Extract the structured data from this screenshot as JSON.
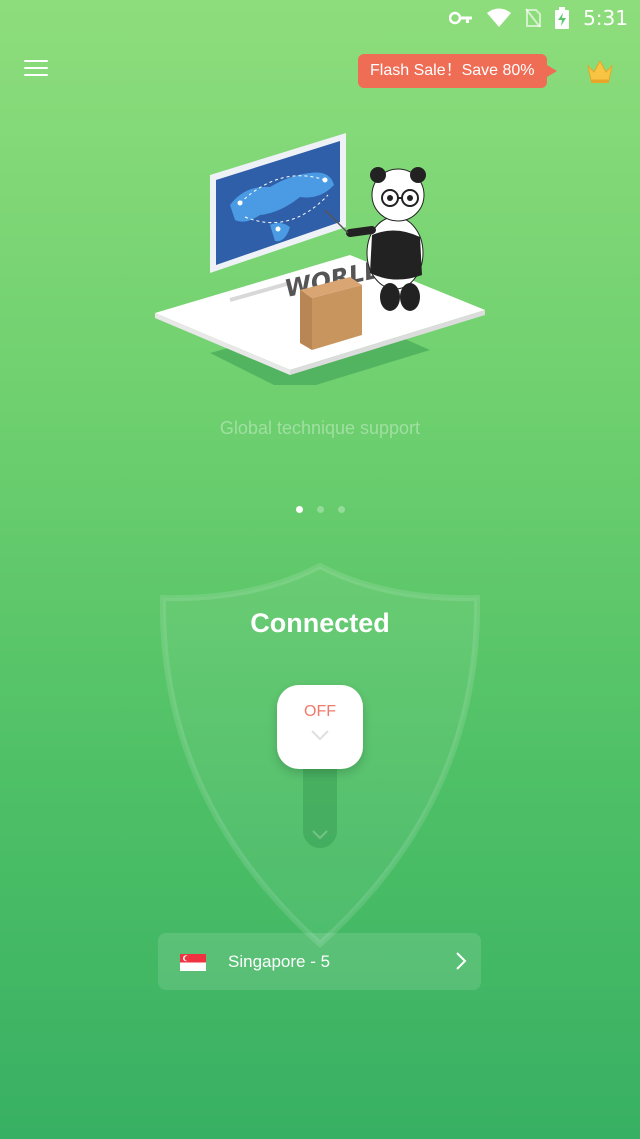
{
  "status_bar": {
    "time": "5:31"
  },
  "header": {
    "flash_sale_label": "Flash Sale！Save 80%"
  },
  "carousel": {
    "illustration_text": "WORLD",
    "caption": "Global technique support",
    "page_count": 3,
    "active_index": 0
  },
  "connection": {
    "status_text": "Connected",
    "toggle_label": "OFF"
  },
  "server": {
    "name": "Singapore - 5"
  },
  "colors": {
    "background_top": "#8edd7c",
    "background_bottom": "#38b063",
    "flash_sale_bg": "#ef6c55",
    "toggle_text": "#ef7a6a"
  },
  "icons": [
    "key-icon",
    "wifi-icon",
    "no-sim-icon",
    "battery-charging-icon",
    "menu-icon",
    "crown-icon",
    "chevron-down-icon",
    "singapore-flag-icon",
    "chevron-right-icon"
  ]
}
